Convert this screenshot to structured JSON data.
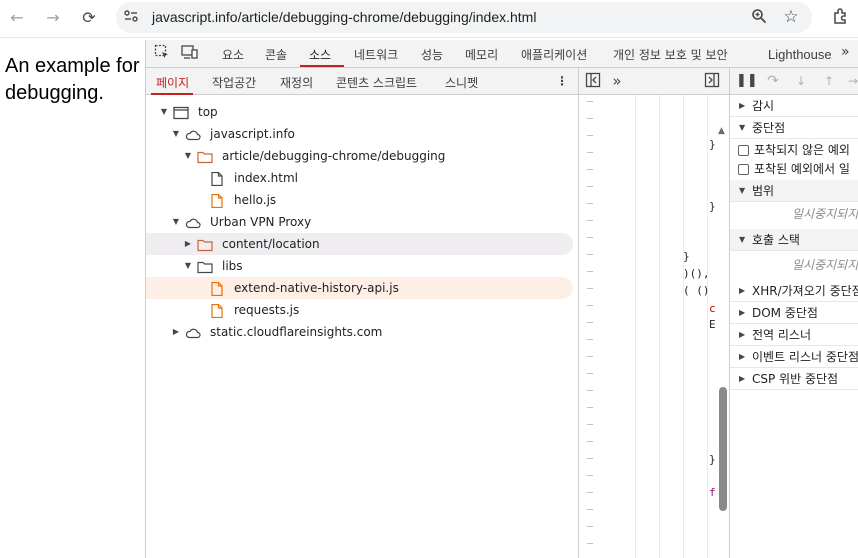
{
  "browser": {
    "url": "javascript.info/article/debugging-chrome/debugging/index.html"
  },
  "page": {
    "text": "An example for debugging."
  },
  "devtools": {
    "main_tabs": [
      "요소",
      "콘솔",
      "소스",
      "네트워크",
      "성능",
      "메모리",
      "애플리케이션",
      "개인 정보 보호 및 보안",
      "Lighthouse"
    ],
    "main_active": "소스",
    "sub_tabs": [
      "페이지",
      "작업공간",
      "재정의",
      "콘텐츠 스크립트",
      "스니펫"
    ],
    "sub_active": "페이지",
    "tree": [
      {
        "label": "top",
        "icon": "frame-icon",
        "expanded": true
      },
      {
        "label": "javascript.info",
        "icon": "cloud-icon",
        "expanded": true
      },
      {
        "label": "article/debugging-chrome/debugging",
        "icon": "folder-icon",
        "expanded": true
      },
      {
        "label": "index.html",
        "icon": "file-icon"
      },
      {
        "label": "hello.js",
        "icon": "file-js-icon"
      },
      {
        "label": "Urban VPN Proxy",
        "icon": "cloud-icon",
        "expanded": true
      },
      {
        "label": "content/location",
        "icon": "folder-icon",
        "expanded": false
      },
      {
        "label": "libs",
        "icon": "folder-icon",
        "expanded": true
      },
      {
        "label": "extend-native-history-api.js",
        "icon": "file-js-icon",
        "selected": true
      },
      {
        "label": "requests.js",
        "icon": "file-js-icon"
      },
      {
        "label": "static.cloudflareinsights.com",
        "icon": "cloud-icon",
        "expanded": false
      }
    ],
    "debugger": {
      "watch": "감시",
      "breakpoints": "중단점",
      "bp_uncaught": "포착되지 않은 예외",
      "bp_caught": "포착된 예외에서 일",
      "scope": "범위",
      "not_paused_1": "일시중지되지",
      "call_stack": "호출 스택",
      "not_paused_2": "일시중지되지",
      "xhr": "XHR/가져오기 중단점",
      "dom": "DOM 중단점",
      "global": "전역 리스너",
      "event": "이벤트 리스너 중단점",
      "csp": "CSP 위반 중단점"
    }
  }
}
